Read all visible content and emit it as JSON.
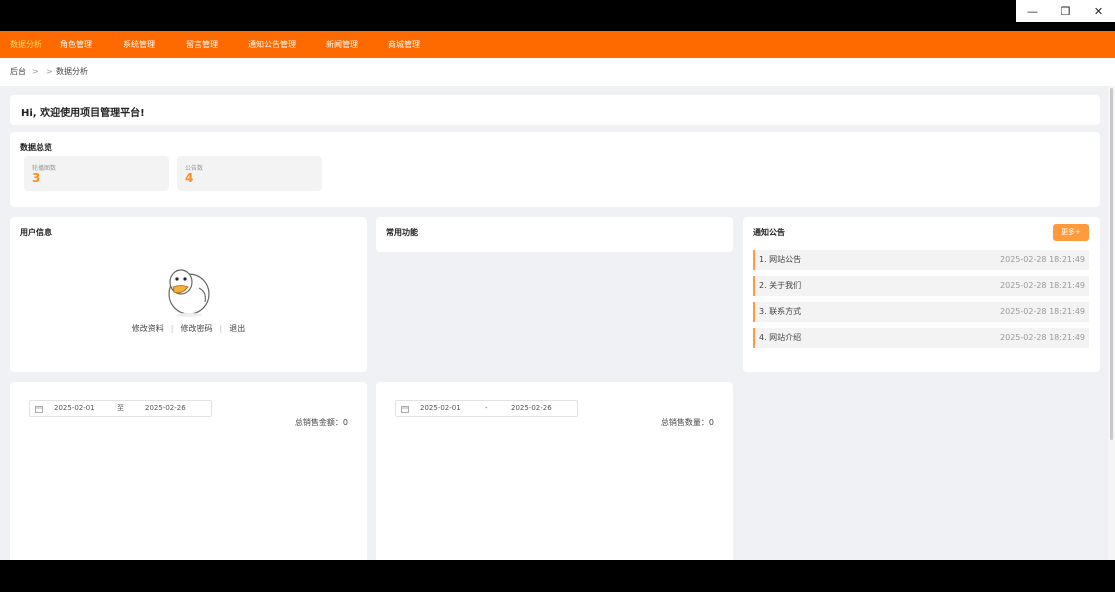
{
  "window": {
    "minimize_glyph": "—",
    "restore_glyph": "❐",
    "close_glyph": "✕"
  },
  "nav": {
    "items": [
      "数据分析",
      "角色管理",
      "系统管理",
      "留言管理",
      "通知公告管理",
      "新闻管理",
      "商城管理"
    ],
    "active_index": 0
  },
  "breadcrumb": {
    "root": "后台",
    "sep1": ">",
    "sep2": ">",
    "current": "数据分析"
  },
  "welcome": {
    "text": "Hi, 欢迎使用项目管理平台!"
  },
  "overview": {
    "title": "数据总览",
    "stats": [
      {
        "label": "轮播图数",
        "value": "3"
      },
      {
        "label": "公告数",
        "value": "4"
      }
    ]
  },
  "user_info": {
    "title": "用户信息",
    "links": [
      "修改资料",
      "修改密码",
      "退出"
    ],
    "separator": "|"
  },
  "common": {
    "title": "常用功能"
  },
  "notices": {
    "title": "通知公告",
    "more_label": "更多+",
    "items": [
      {
        "title": "1. 网站公告",
        "date": "2025-02-28 18:21:49"
      },
      {
        "title": "2. 关于我们",
        "date": "2025-02-28 18:21:49"
      },
      {
        "title": "3. 联系方式",
        "date": "2025-02-28 18:21:49"
      },
      {
        "title": "4. 网站介绍",
        "date": "2025-02-28 18:21:49"
      }
    ]
  },
  "sales_amount": {
    "start": "2025-02-01",
    "sep": "至",
    "end": "2025-02-26",
    "total_label": "总销售金额：",
    "total_value": "0"
  },
  "sales_count": {
    "start": "2025-02-01",
    "sep": "-",
    "end": "2025-02-26",
    "total_label": "总销售数量：",
    "total_value": "0"
  },
  "colors": {
    "nav_bg": "#ff6a00",
    "accent": "#ff9a3d",
    "stat_value": "#ff8c1a",
    "page_bg": "#f0f1f4"
  },
  "icons": {
    "calendar": "calendar-icon",
    "avatar": "duck-avatar-icon"
  }
}
